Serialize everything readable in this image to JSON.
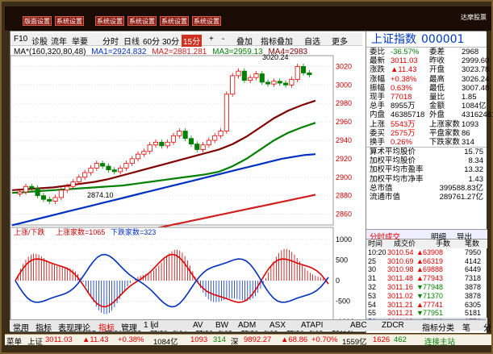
{
  "app": {
    "brand": "达摩股票",
    "top_buttons": [
      "版面设置",
      "系统设置",
      "系统设置",
      "系统设置",
      "系统设置",
      "系统设置"
    ]
  },
  "toolbar": {
    "f10": "F10",
    "diagnose": "诊股",
    "flow": "流年",
    "wheel": "举要",
    "periods": [
      "分时",
      "日线",
      "60分",
      "30分",
      "15分"
    ],
    "active_period": "15分",
    "plus": "+",
    "minus": "-",
    "overlay": "叠加",
    "indicator_overlay": "指标叠加",
    "self_select": "自选",
    "more": "更多"
  },
  "ma_legend": {
    "params": "MA*(160,320,80,48)",
    "ma1": "MA1=2924.832",
    "ma2": "MA2=2881.281",
    "ma3": "MA3=2959.13",
    "ma4": "MA4=2983"
  },
  "chart": {
    "high_label": "3020.24",
    "low_label": "2874.10",
    "price_axis": [
      "3020",
      "3000",
      "2980",
      "2960",
      "2940",
      "2920",
      "2900",
      "2880",
      "2860"
    ],
    "date_axis": [
      "8/29",
      "8/30",
      "11:30",
      "9/02",
      "11:30",
      "9/03",
      "11:30",
      "9/04",
      "11:30",
      "9/05",
      "11:30",
      "9/06",
      "11:30",
      "9/09"
    ],
    "sub_legend_prefix": "上涨/下跌",
    "sub_up": "上涨家数=1065",
    "sub_down": "下跌家数=323",
    "sub_axis": [
      "1000",
      "500",
      "0",
      "-500",
      "-1000"
    ],
    "time_label": "15分钟"
  },
  "chart_data": {
    "type": "line",
    "title": "",
    "price": [
      2884,
      2890,
      2888,
      2880,
      2876,
      2874,
      2878,
      2886,
      2890,
      2895,
      2900,
      2905,
      2910,
      2915,
      2912,
      2908,
      2906,
      2910,
      2915,
      2920,
      2925,
      2928,
      2935,
      2938,
      2934,
      2938,
      2945,
      2950,
      2942,
      2936,
      2930,
      2935,
      2940,
      2945,
      2950,
      2990,
      3010,
      3015,
      3005,
      3008,
      3012,
      3003,
      3001,
      3004,
      3002,
      3000,
      3006,
      3020,
      3013,
      3011
    ],
    "ma_series": [
      {
        "name": "MA1",
        "values": [
          2848,
          2851,
          2854,
          2857,
          2860,
          2863,
          2866,
          2869,
          2872,
          2875,
          2878,
          2881,
          2884,
          2887,
          2890,
          2893,
          2896,
          2899,
          2902,
          2905,
          2908,
          2911,
          2914,
          2917,
          2920,
          2922,
          2924,
          2925
        ]
      },
      {
        "name": "MA2",
        "values": [
          2845,
          2847,
          2849,
          2851,
          2853,
          2855,
          2857,
          2859,
          2861,
          2863,
          2865,
          2867,
          2869,
          2871,
          2873,
          2875,
          2877,
          2879,
          2881
        ]
      },
      {
        "name": "MA3",
        "values": [
          2883,
          2884,
          2885,
          2886,
          2887,
          2888,
          2889,
          2890,
          2891,
          2893,
          2895,
          2897,
          2899,
          2901,
          2903,
          2906,
          2912,
          2920,
          2930,
          2940,
          2948,
          2954,
          2959
        ]
      },
      {
        "name": "MA4",
        "values": [
          2886,
          2887,
          2888,
          2889,
          2891,
          2893,
          2895,
          2898,
          2902,
          2906,
          2910,
          2914,
          2918,
          2922,
          2926,
          2930,
          2936,
          2944,
          2954,
          2964,
          2972,
          2978,
          2983
        ]
      }
    ],
    "ylim": [
      2850,
      3030
    ]
  },
  "quote": {
    "name": "上证指数",
    "code": "000001",
    "rows": [
      {
        "l1": "委比",
        "v1": "-36.57%",
        "l2": "委差",
        "v2": "2968"
      },
      {
        "l1": "最新",
        "v1": "3011.03",
        "l2": "昨收",
        "v2": "2999.60"
      },
      {
        "l1": "涨跌",
        "v1": "▲11.43",
        "l2": "开盘",
        "v2": "3023.78"
      },
      {
        "l1": "涨幅",
        "v1": "+0.38%",
        "l2": "最高",
        "v2": "3026.24"
      },
      {
        "l1": "振幅",
        "v1": "0.63%",
        "l2": "最低",
        "v2": "3007.48"
      },
      {
        "l1": "现手",
        "v1": "77018",
        "l2": "量比",
        "v2": "1.85"
      },
      {
        "l1": "总手",
        "v1": "8955万",
        "l2": "金额",
        "v2": "1084亿"
      },
      {
        "l1": "内盘",
        "v1": "46385718",
        "l2": "外盘",
        "v2": "43162461"
      },
      {
        "l1": "上涨",
        "v1": "5543万",
        "l2": "上涨家数",
        "v2": "1093"
      },
      {
        "l1": "委买",
        "v1": "2575万",
        "l2": "平盘家数",
        "v2": "86"
      },
      {
        "l1": "换手",
        "v1": "0.26%",
        "l2": "下跌家数",
        "v2": "314"
      }
    ],
    "rows2": [
      {
        "l": "算术平均股价",
        "v": "15.75"
      },
      {
        "l": "加权平均股价",
        "v": "8.34"
      },
      {
        "l": "加权平均市盈率",
        "v": "13.32"
      },
      {
        "l": "加权平均市净率",
        "v": "1.43"
      },
      {
        "l": "总市值",
        "v": "399588.83亿"
      },
      {
        "l": "流通市值",
        "v": "289761.27亿"
      }
    ]
  },
  "trades": {
    "tabs": [
      "分时成交",
      "明细",
      "导出"
    ],
    "headers": [
      "时间",
      "成交价",
      "手数",
      "笔数"
    ],
    "rows": [
      {
        "t": "10:20",
        "p": "3010.54",
        "d": "▲",
        "v": "63908",
        "n": "7950"
      },
      {
        "t": "25",
        "p": "3010.69",
        "d": "▲",
        "v": "66319",
        "n": "4142"
      },
      {
        "t": "30",
        "p": "3010.98",
        "d": "▲",
        "v": "69888",
        "n": "6449"
      },
      {
        "t": "31",
        "p": "3011.48",
        "d": "▲",
        "v": "77943",
        "n": "7318"
      },
      {
        "t": "32",
        "p": "3011.16",
        "d": "▼",
        "v": "77948",
        "n": "3878"
      },
      {
        "t": "53",
        "p": "3011.02",
        "d": "▼",
        "v": "71370",
        "n": "3878"
      },
      {
        "t": "54",
        "p": "3011.21",
        "d": "▲",
        "v": "77741",
        "n": "6305"
      },
      {
        "t": "55",
        "p": "3011.21",
        "d": "▼",
        "v": "77951",
        "n": "5181"
      },
      {
        "t": "56",
        "p": "3011.03",
        "d": "▼",
        "v": "77018",
        "n": "3776"
      }
    ]
  },
  "bottom_tabs": [
    "常用",
    "指标",
    "表现理论",
    "指标",
    "管理",
    "1 ljd",
    "AV",
    "BW",
    "ADM",
    "ASX",
    "ATAPI",
    "ABC",
    "ZDCR",
    "指标分类",
    "笔",
    "分时",
    "短线"
  ],
  "status": {
    "index": "上证",
    "price": "3011.03",
    "chg": "▲11.43",
    "pct": "+0.38%",
    "amount": "1084亿",
    "up": "1093",
    "flat": "314",
    "idx2": "深",
    "price2": "9892.27",
    "chg2": "▲68.86",
    "pct2": "+0.70%",
    "amount2": "1559亿",
    "up2": "1626",
    "down2": "462",
    "connect": "连接主站",
    "menu": "菜单"
  }
}
